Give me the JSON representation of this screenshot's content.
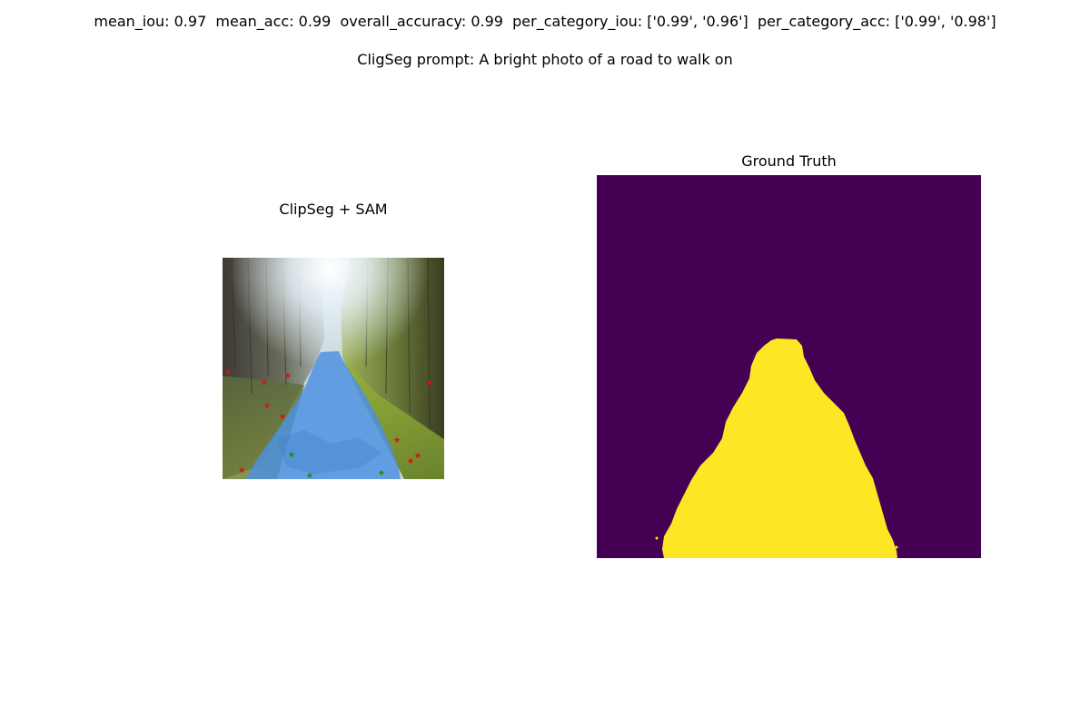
{
  "figure": {
    "metrics_text": "mean_iou: 0.97  mean_acc: 0.99  overall_accuracy: 0.99  per_category_iou: ['0.99', '0.96']  per_category_acc: ['0.99', '0.98']",
    "prompt_text": "CligSeg prompt: A bright photo of a road to walk on"
  },
  "chart_data": [
    {
      "type": "other",
      "title": "ClipSeg + SAM",
      "description_kind": "image with predicted mask overlay and prompt points",
      "mask_color": "#4a90e2",
      "point_colors": {
        "positive": "#1a8a1a",
        "negative": "#e01010"
      }
    },
    {
      "type": "heatmap",
      "title": "Ground Truth",
      "colormap": [
        "#440154",
        "#fde725"
      ],
      "classes": [
        0,
        1
      ]
    }
  ]
}
